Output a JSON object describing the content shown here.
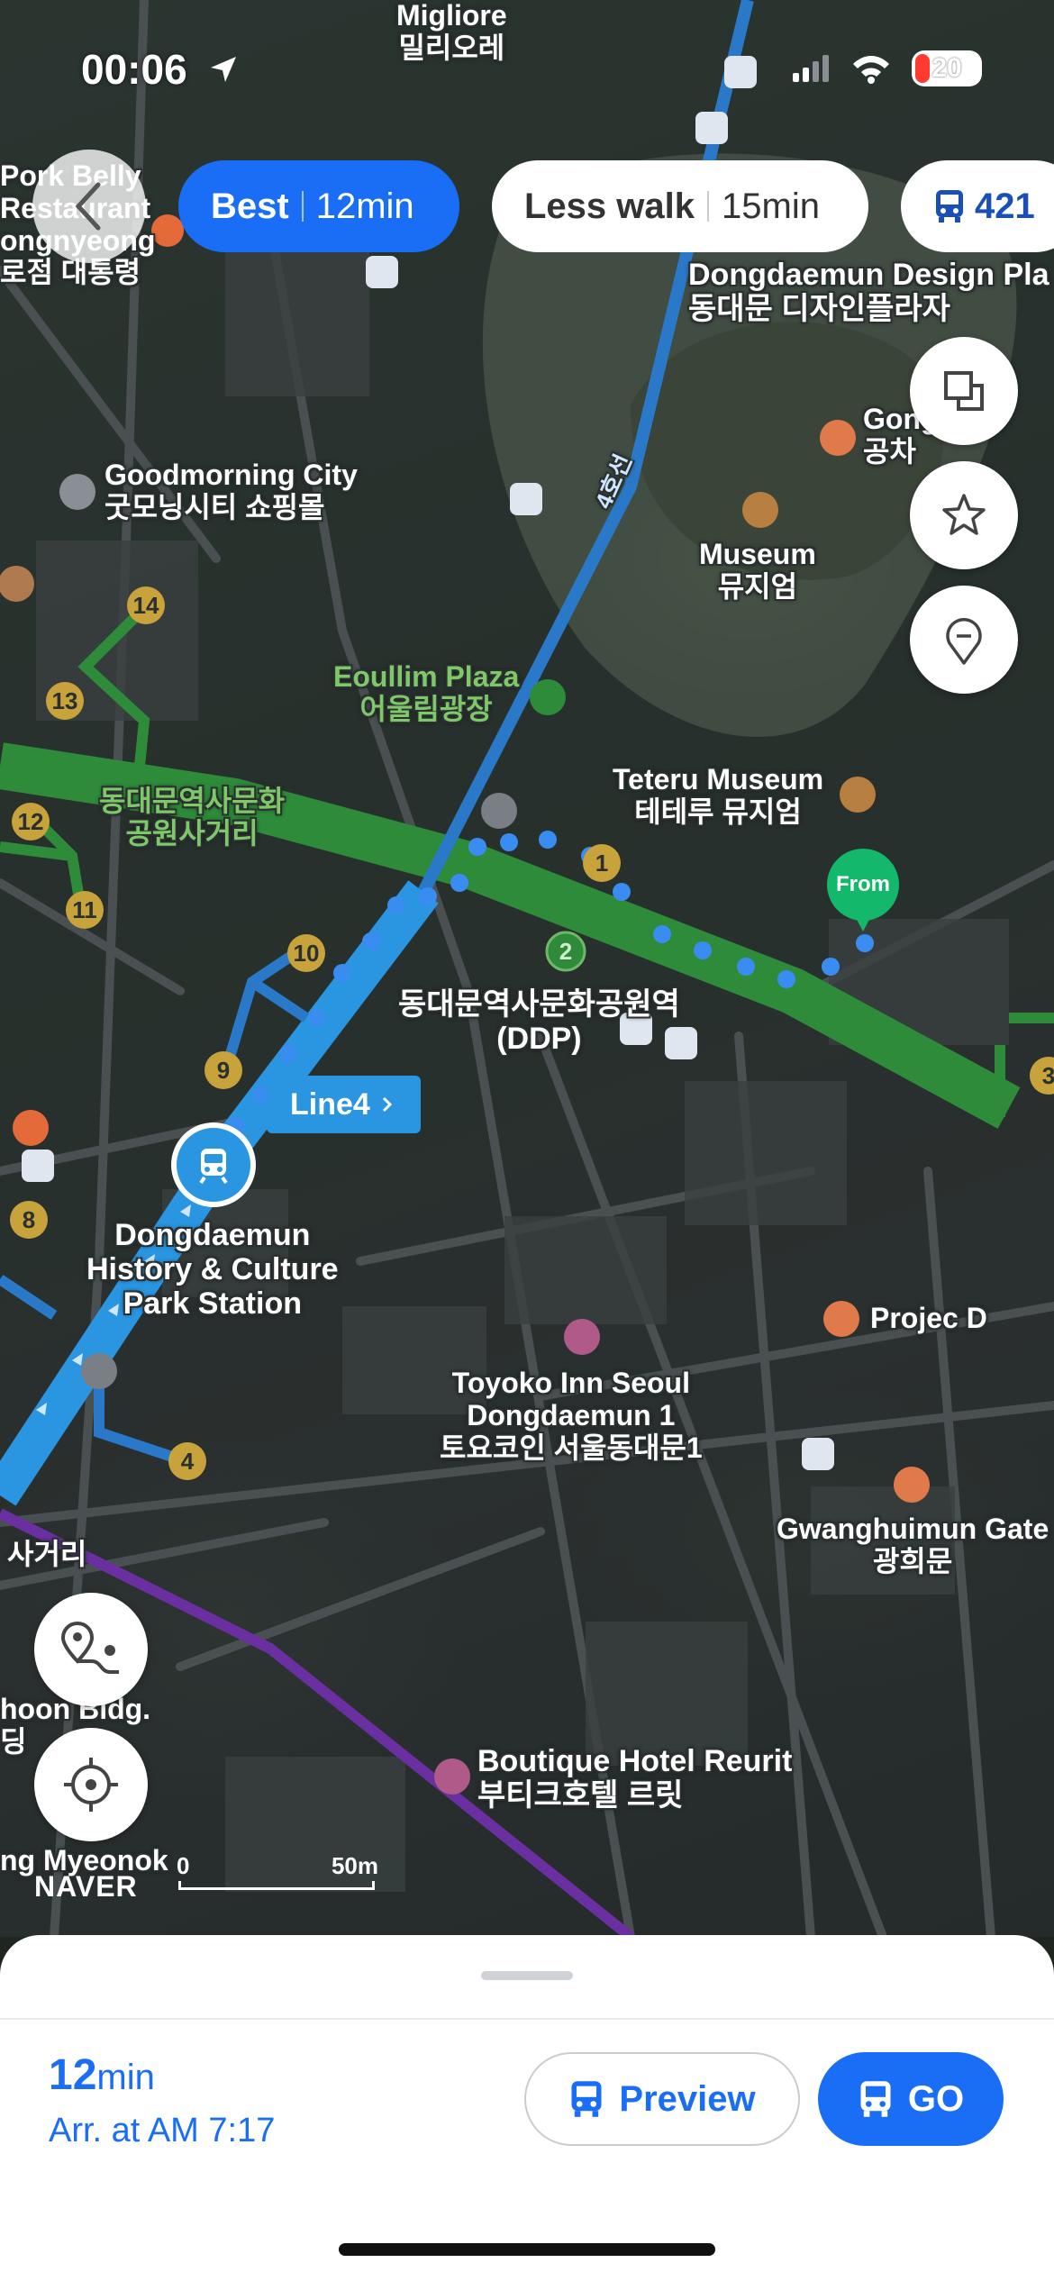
{
  "status_bar": {
    "time": "00:06",
    "battery": "20"
  },
  "route_options": {
    "best": {
      "label": "Best",
      "time": "12min"
    },
    "less_walk": {
      "label": "Less walk",
      "time": "15min"
    },
    "bus": {
      "label": "421"
    }
  },
  "map_labels": {
    "migliore": "Migliore\n밀리오레",
    "pork_belly": "Pork Belly\nRestaurant\nongnyeong\n로점 대통령",
    "ddp_plaza": "Dongdaemun Design Pla\n동대문 디자인플라자",
    "gong_cha": "Gong\n공차",
    "goodmorning": "Goodmorning City\n굿모닝시티 쇼핑몰",
    "museum": "Museum\n뮤지엄",
    "eoullim": "Eoullim Plaza\n어울림광장",
    "teteru": "Teteru Museum\n테테루 뮤지엄",
    "ddp_junction": "동대문역사문화\n공원사거리",
    "ddp_station_kr": "동대문역사문화공원역\n(DDP)",
    "station_name": "Dongdaemun\nHistory & Culture\nPark Station",
    "project_d": "Projec D",
    "toyoko": "Toyoko Inn Seoul\nDongdaemun 1\n토요코인 서울동대문1",
    "gwanghuimun": "Gwanghuimun Gate\n광희문",
    "sageori": "사거리",
    "hoon_bldg": "hoon Bldg.\n딩",
    "boutique": "Boutique Hotel Reurit\n부티크호텔 르릿",
    "myeongk": "ng Myeonok",
    "line4_road": "4호선"
  },
  "exit_numbers": [
    "14",
    "13",
    "12",
    "11",
    "10",
    "9",
    "8",
    "4",
    "1",
    "2",
    "3"
  ],
  "from_pin": "From",
  "line_tag": "Line4",
  "scale": {
    "zero": "0",
    "max": "50m"
  },
  "brand": "NAVER",
  "bottom_sheet": {
    "duration_value": "12",
    "duration_unit": "min",
    "arrival": "Arr. at AM 7:17",
    "preview_label": "Preview",
    "go_label": "GO"
  },
  "colors": {
    "accent": "#1a6ef5",
    "line4": "#2a95e0",
    "line2": "#2e8b3a",
    "line5": "#6a2fa0",
    "walk_dots": "#3a8df0",
    "from_pin": "#14b86a",
    "exit_badge": "#c8a23a"
  }
}
